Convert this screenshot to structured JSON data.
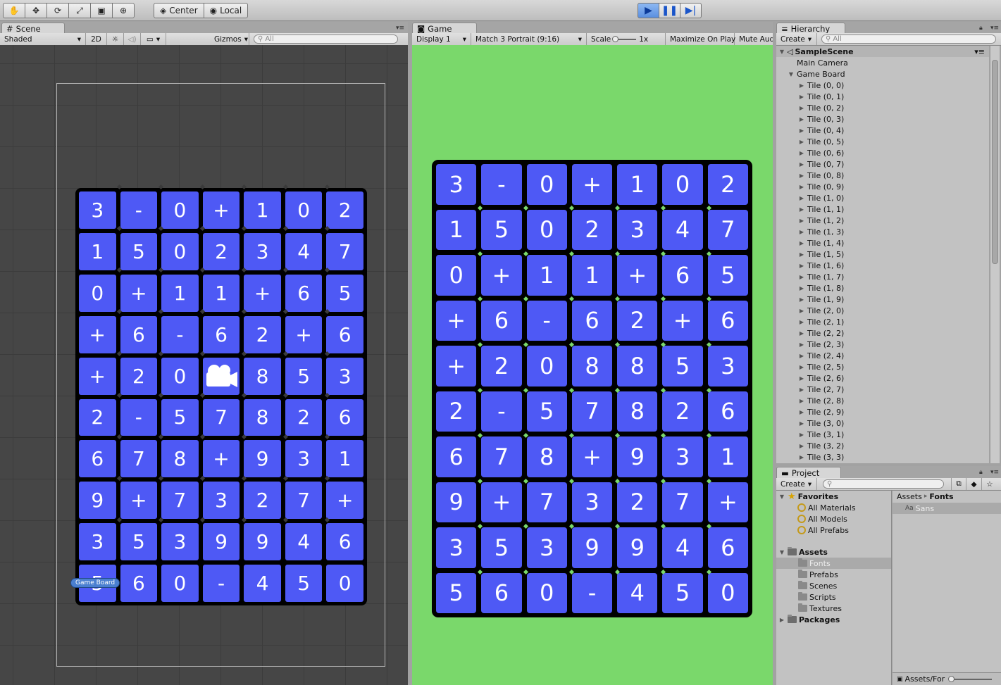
{
  "toolbar": {
    "pivot_center": "Center",
    "pivot_local": "Local"
  },
  "scene": {
    "tab": "Scene",
    "shading": "Shaded",
    "mode_2d": "2D",
    "gizmos": "Gizmos",
    "search_placeholder": "All",
    "gameboard_label": "Game Board"
  },
  "game": {
    "tab": "Game",
    "display": "Display 1",
    "aspect": "Match 3 Portrait (9:16)",
    "scale_label": "Scale",
    "scale_value": "1x",
    "maximize": "Maximize On Play",
    "mute": "Mute Audi"
  },
  "hierarchy": {
    "tab": "Hierarchy",
    "create": "Create",
    "search_placeholder": "All",
    "scene_name": "SampleScene",
    "items": [
      "Main Camera",
      "Game Board"
    ],
    "tiles": [
      "Tile (0, 0)",
      "Tile (0, 1)",
      "Tile (0, 2)",
      "Tile (0, 3)",
      "Tile (0, 4)",
      "Tile (0, 5)",
      "Tile (0, 6)",
      "Tile (0, 7)",
      "Tile (0, 8)",
      "Tile (0, 9)",
      "Tile (1, 0)",
      "Tile (1, 1)",
      "Tile (1, 2)",
      "Tile (1, 3)",
      "Tile (1, 4)",
      "Tile (1, 5)",
      "Tile (1, 6)",
      "Tile (1, 7)",
      "Tile (1, 8)",
      "Tile (1, 9)",
      "Tile (2, 0)",
      "Tile (2, 1)",
      "Tile (2, 2)",
      "Tile (2, 3)",
      "Tile (2, 4)",
      "Tile (2, 5)",
      "Tile (2, 6)",
      "Tile (2, 7)",
      "Tile (2, 8)",
      "Tile (2, 9)",
      "Tile (3, 0)",
      "Tile (3, 1)",
      "Tile (3, 2)",
      "Tile (3, 3)"
    ]
  },
  "project": {
    "tab": "Project",
    "create": "Create",
    "favorites": "Favorites",
    "fav_items": [
      "All Materials",
      "All Models",
      "All Prefabs"
    ],
    "assets": "Assets",
    "asset_folders": [
      "Fonts",
      "Prefabs",
      "Scenes",
      "Scripts",
      "Textures"
    ],
    "packages": "Packages",
    "breadcrumb_root": "Assets",
    "breadcrumb_current": "Fonts",
    "files": [
      "Sans"
    ],
    "footer_path": "Assets/For"
  },
  "board": {
    "rows": [
      [
        "3",
        "-",
        "0",
        "+",
        "1",
        "0",
        "2"
      ],
      [
        "1",
        "5",
        "0",
        "2",
        "3",
        "4",
        "7"
      ],
      [
        "0",
        "+",
        "1",
        "1",
        "+",
        "6",
        "5"
      ],
      [
        "+",
        "6",
        "-",
        "6",
        "2",
        "+",
        "6"
      ],
      [
        "+",
        "2",
        "0",
        "8",
        "8",
        "5",
        "3"
      ],
      [
        "2",
        "-",
        "5",
        "7",
        "8",
        "2",
        "6"
      ],
      [
        "6",
        "7",
        "8",
        "+",
        "9",
        "3",
        "1"
      ],
      [
        "9",
        "+",
        "7",
        "3",
        "2",
        "7",
        "+"
      ],
      [
        "3",
        "5",
        "3",
        "9",
        "9",
        "4",
        "6"
      ],
      [
        "5",
        "6",
        "0",
        "-",
        "4",
        "5",
        "0"
      ]
    ],
    "tile_color": "#4e59f5",
    "game_background": "#7ad86b"
  }
}
